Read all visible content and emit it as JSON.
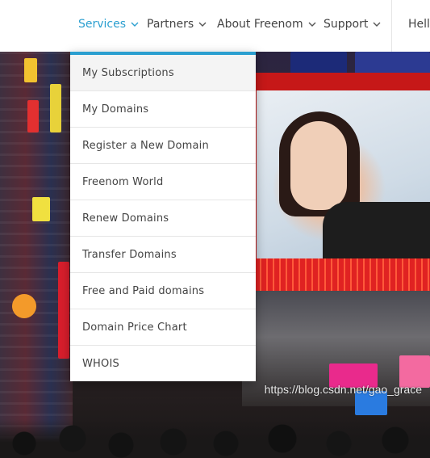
{
  "nav": {
    "items": [
      {
        "label": "Services",
        "active": true
      },
      {
        "label": "Partners",
        "active": false
      },
      {
        "label": "About Freenom",
        "active": false
      },
      {
        "label": "Support",
        "active": false
      }
    ],
    "greeting": "Hello"
  },
  "dropdown": {
    "items": [
      "My Subscriptions",
      "My Domains",
      "Register a New Domain",
      "Freenom World",
      "Renew Domains",
      "Transfer Domains",
      "Free and Paid domains",
      "Domain Price Chart",
      "WHOIS"
    ]
  },
  "watermark": "https://blog.csdn.net/gao_grace",
  "colors": {
    "accent": "#2b9fd0",
    "text": "#444444",
    "menu_hover_bg": "#f4f4f4"
  },
  "icons": {
    "nav_chevron": "chevron-down-icon"
  }
}
